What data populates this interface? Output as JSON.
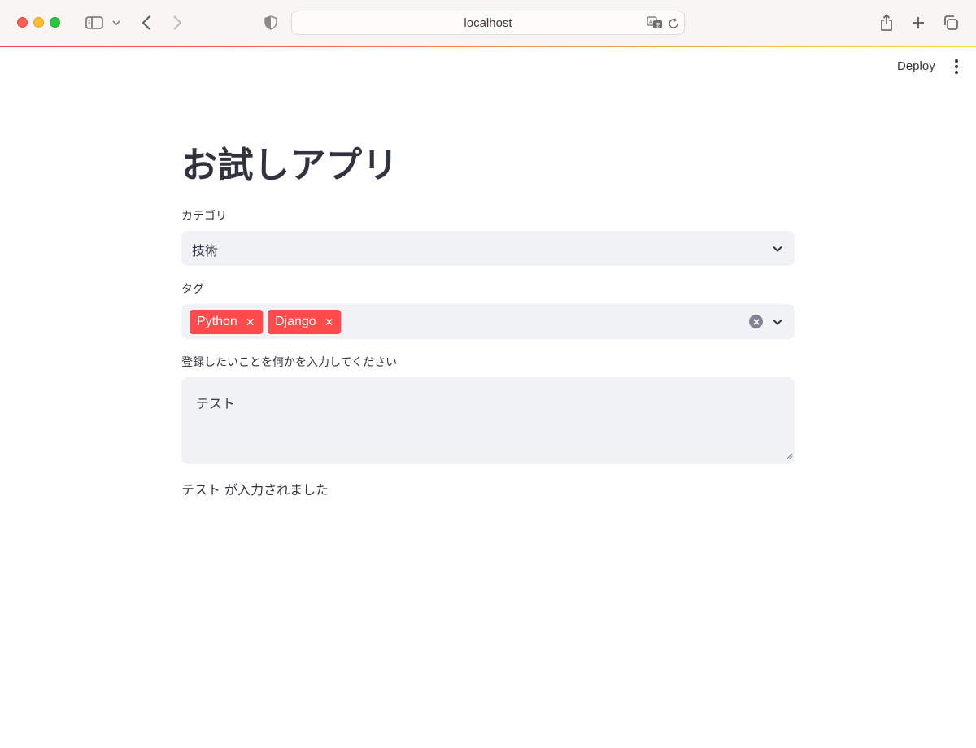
{
  "browser": {
    "url": "localhost"
  },
  "header": {
    "deploy_label": "Deploy"
  },
  "main": {
    "title": "お試しアプリ",
    "category": {
      "label": "カテゴリ",
      "value": "技術"
    },
    "tags": {
      "label": "タグ",
      "selected": [
        "Python",
        "Django"
      ]
    },
    "input": {
      "label": "登録したいことを何かを入力してください",
      "value": "テスト"
    },
    "output_text": "テスト が入力されました"
  },
  "colors": {
    "accent": "#ff4b4b",
    "input_bg": "#f0f2f6",
    "text": "#31333f"
  }
}
